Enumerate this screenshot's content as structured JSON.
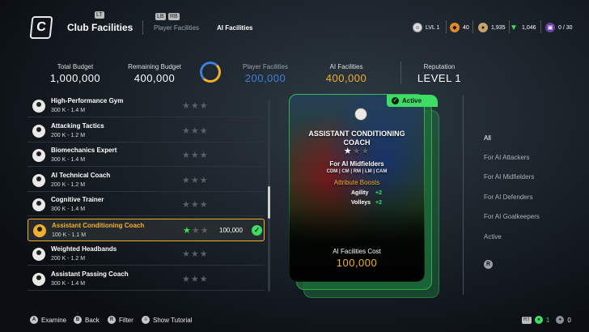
{
  "header": {
    "title": "Club Facilities",
    "tabs": [
      {
        "label": "Player Facilities",
        "active": false
      },
      {
        "label": "AI Facilities",
        "active": true
      }
    ],
    "hints": {
      "logo": "LT",
      "left": "LB",
      "right": "RB"
    },
    "stats": {
      "level": "LVL 1",
      "xp": "40",
      "coins": "1,935",
      "points": "1,046",
      "slots": "0 / 30"
    }
  },
  "budget": {
    "total_label": "Total Budget",
    "total_value": "1,000,000",
    "remaining_label": "Remaining Budget",
    "remaining_value": "400,000",
    "player_label": "Player Facilities",
    "player_value": "200,000",
    "ai_label": "AI Facilities",
    "ai_value": "400,000",
    "reputation_label": "Reputation",
    "reputation_value": "LEVEL 1"
  },
  "facilities": [
    {
      "name": "High-Performance Gym",
      "range": "300 K - 1.4 M",
      "stars": 0,
      "cost": "",
      "selected": false
    },
    {
      "name": "Attacking Tactics",
      "range": "200 K - 1.2 M",
      "stars": 0,
      "cost": "",
      "selected": false
    },
    {
      "name": "Biomechanics Expert",
      "range": "300 K - 1.4 M",
      "stars": 0,
      "cost": "",
      "selected": false
    },
    {
      "name": "AI Technical Coach",
      "range": "200 K - 1.2 M",
      "stars": 0,
      "cost": "",
      "selected": false
    },
    {
      "name": "Cognitive Trainer",
      "range": "300 K - 1.4 M",
      "stars": 0,
      "cost": "",
      "selected": false
    },
    {
      "name": "Assistant Conditioning Coach",
      "range": "100 K - 1.1 M",
      "stars": 1,
      "cost": "100,000",
      "selected": true
    },
    {
      "name": "Weighted Headbands",
      "range": "200 K - 1.2 M",
      "stars": 0,
      "cost": "",
      "selected": false
    },
    {
      "name": "Assistant Passing Coach",
      "range": "300 K - 1.4 M",
      "stars": 0,
      "cost": "",
      "selected": false
    }
  ],
  "card": {
    "badge": "Active",
    "title_line1": "ASSISTANT CONDITIONING",
    "title_line2": "COACH",
    "stars": 1,
    "target": "For AI Midfielders",
    "positions": "CDM | CM | RM | LM | CAM",
    "boosts_label": "Attribute Boosts",
    "boosts": [
      {
        "attr": "Agility",
        "value": "+2"
      },
      {
        "attr": "Volleys",
        "value": "+2"
      }
    ],
    "cost_label": "AI Facilities Cost",
    "cost_value": "100,000"
  },
  "filters": [
    {
      "label": "All",
      "active": true
    },
    {
      "label": "For AI Attackers",
      "active": false
    },
    {
      "label": "For AI Midfielders",
      "active": false
    },
    {
      "label": "For AI Defenders",
      "active": false
    },
    {
      "label": "For AI Goalkeepers",
      "active": false
    },
    {
      "label": "Active",
      "active": false
    }
  ],
  "footer": {
    "hints": [
      {
        "button": "A",
        "label": "Examine"
      },
      {
        "button": "B",
        "label": "Back"
      },
      {
        "button": "R",
        "label": "Filter"
      },
      {
        "button": "≡",
        "label": "Show Tutorial"
      }
    ],
    "rt_label": "RT",
    "count_one": "1",
    "count_zero": "0"
  },
  "colors": {
    "accent_green": "#3ddc64",
    "accent_gold": "#f2b02a",
    "player_blue": "#3f7fd8"
  }
}
